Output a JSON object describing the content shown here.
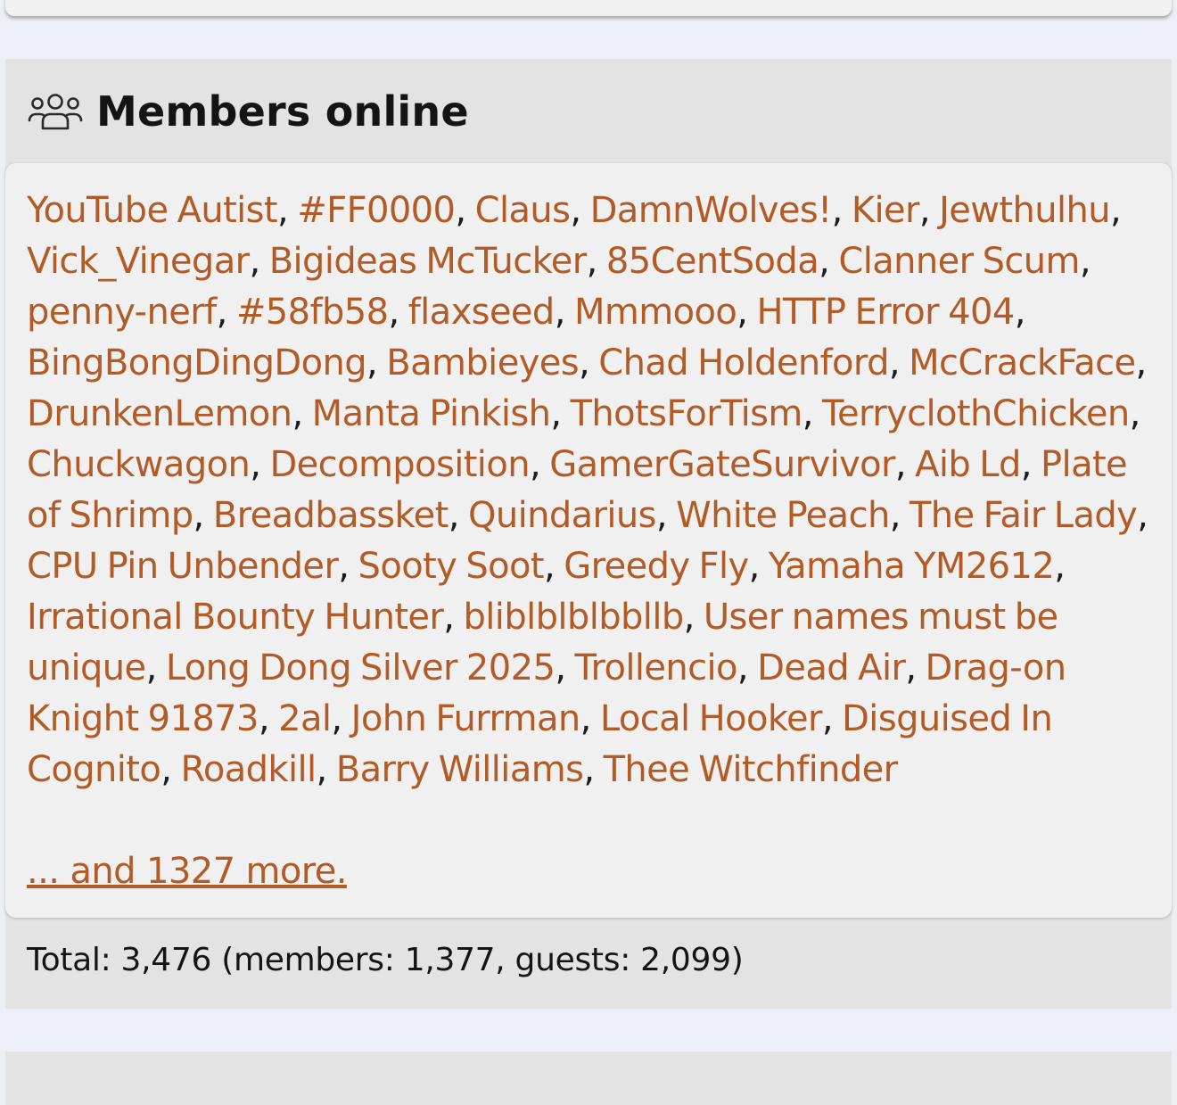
{
  "members_online": {
    "title": "Members online",
    "icon": "users-icon",
    "members": [
      "YouTube Autist",
      "#FF0000",
      "Claus",
      "DamnWolves!",
      "Kier",
      "Jewthulhu",
      "Vick_Vinegar",
      "Bigideas McTucker",
      "85CentSoda",
      "Clanner Scum",
      "penny-nerf",
      "#58fb58",
      "flaxseed",
      "Mmmooo",
      "HTTP Error 404",
      "BingBongDingDong",
      "Bambieyes",
      "Chad Holdenford",
      "McCrackFace",
      "DrunkenLemon",
      "Manta Pinkish",
      "ThotsForTism",
      "TerryclothChicken",
      "Chuckwagon",
      "Decomposition",
      "GamerGateSurvivor",
      "Aib Ld",
      "Plate of Shrimp",
      "Breadbassket",
      "Quindarius",
      "White Peach",
      "The Fair Lady",
      "CPU Pin Unbender",
      "Sooty Soot",
      "Greedy Fly",
      "Yamaha YM2612",
      "Irrational Bounty Hunter",
      "bliblblblbbllb",
      "User names must be unique",
      "Long Dong Silver 2025",
      "Trollencio",
      "Dead Air",
      "Drag-on Knight 91873",
      "2al",
      "John Furrman",
      "Local Hooker",
      "Disguised In Cognito",
      "Roadkill",
      "Barry Williams",
      "Thee Witchfinder"
    ],
    "more_link": "... and 1327 more.",
    "footer": "Total: 3,476 (members: 1,377, guests: 2,099)"
  },
  "colors": {
    "link": "#b35b26",
    "page_bg": "#eceff6",
    "block_bg": "#e3e3e3",
    "body_bg": "#f0f0f0"
  }
}
